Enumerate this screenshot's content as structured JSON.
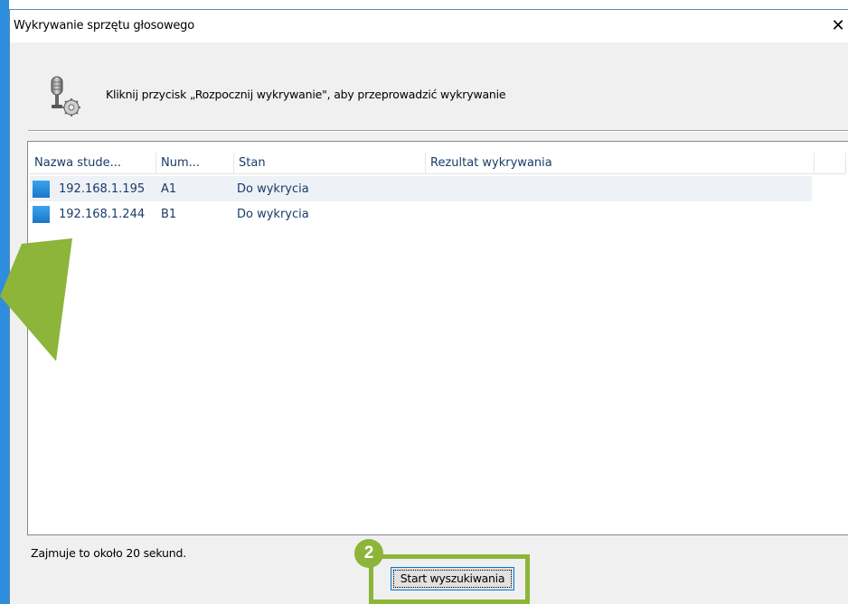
{
  "window": {
    "title": "Wykrywanie sprzętu głosowego",
    "close_glyph": "✕"
  },
  "instruction": {
    "icon": "microphone-settings-icon",
    "text": "Kliknij przycisk „Rozpocznij wykrywanie\", aby przeprowadzić wykrywanie"
  },
  "table": {
    "headers": [
      "Nazwa stude...",
      "Num...",
      "Stan",
      "Rezultat wykrywania"
    ],
    "rows": [
      {
        "name": "192.168.1.195",
        "number": "A1",
        "status": "Do wykrycia",
        "result": ""
      },
      {
        "name": "192.168.1.244",
        "number": "B1",
        "status": "Do wykrycia",
        "result": ""
      }
    ]
  },
  "footer": {
    "note": "Zajmuje to około 20 sekund.",
    "start_button": "Start wyszukiwania",
    "step_badge": "2"
  },
  "colors": {
    "accent_green": "#8cb539",
    "header_text": "#1a3b68",
    "device_icon": "#1a76c8",
    "focus_border": "#0078d7"
  }
}
